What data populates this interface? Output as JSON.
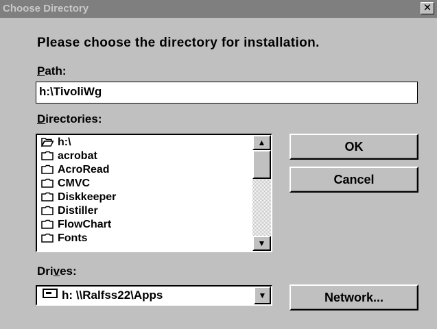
{
  "window": {
    "title": "Choose Directory",
    "close_glyph": "✕"
  },
  "prompt": "Please choose the directory for installation.",
  "path": {
    "label_u": "P",
    "label_rest": "ath:",
    "value": "h:\\TivoliWg"
  },
  "directories": {
    "label_u": "D",
    "label_rest": "irectories:",
    "items": [
      {
        "name": "h:\\",
        "icon": "open-folder-icon"
      },
      {
        "name": "acrobat",
        "icon": "folder-icon"
      },
      {
        "name": "AcroRead",
        "icon": "folder-icon"
      },
      {
        "name": "CMVC",
        "icon": "folder-icon"
      },
      {
        "name": "Diskkeeper",
        "icon": "folder-icon"
      },
      {
        "name": "Distiller",
        "icon": "folder-icon"
      },
      {
        "name": "FlowChart",
        "icon": "folder-icon"
      },
      {
        "name": "Fonts",
        "icon": "folder-icon"
      }
    ]
  },
  "drives": {
    "label_pre": "Dri",
    "label_u": "v",
    "label_post": "es:",
    "value": "h: \\\\Ralfss22\\Apps",
    "icon": "network-drive-icon"
  },
  "buttons": {
    "ok": "OK",
    "cancel": "Cancel",
    "network": "Network..."
  },
  "scroll_arrows": {
    "up": "▲",
    "down": "▼"
  }
}
